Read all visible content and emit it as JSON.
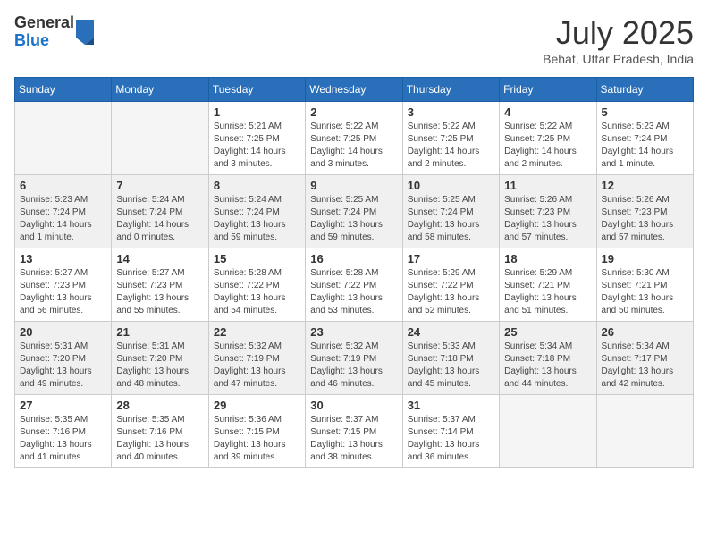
{
  "logo": {
    "general": "General",
    "blue": "Blue"
  },
  "header": {
    "month_year": "July 2025",
    "location": "Behat, Uttar Pradesh, India"
  },
  "weekdays": [
    "Sunday",
    "Monday",
    "Tuesday",
    "Wednesday",
    "Thursday",
    "Friday",
    "Saturday"
  ],
  "weeks": [
    {
      "shaded": false,
      "days": [
        {
          "num": "",
          "empty": true
        },
        {
          "num": "",
          "empty": true
        },
        {
          "num": "1",
          "sunrise": "Sunrise: 5:21 AM",
          "sunset": "Sunset: 7:25 PM",
          "daylight": "Daylight: 14 hours and 3 minutes."
        },
        {
          "num": "2",
          "sunrise": "Sunrise: 5:22 AM",
          "sunset": "Sunset: 7:25 PM",
          "daylight": "Daylight: 14 hours and 3 minutes."
        },
        {
          "num": "3",
          "sunrise": "Sunrise: 5:22 AM",
          "sunset": "Sunset: 7:25 PM",
          "daylight": "Daylight: 14 hours and 2 minutes."
        },
        {
          "num": "4",
          "sunrise": "Sunrise: 5:22 AM",
          "sunset": "Sunset: 7:25 PM",
          "daylight": "Daylight: 14 hours and 2 minutes."
        },
        {
          "num": "5",
          "sunrise": "Sunrise: 5:23 AM",
          "sunset": "Sunset: 7:24 PM",
          "daylight": "Daylight: 14 hours and 1 minute."
        }
      ]
    },
    {
      "shaded": true,
      "days": [
        {
          "num": "6",
          "sunrise": "Sunrise: 5:23 AM",
          "sunset": "Sunset: 7:24 PM",
          "daylight": "Daylight: 14 hours and 1 minute."
        },
        {
          "num": "7",
          "sunrise": "Sunrise: 5:24 AM",
          "sunset": "Sunset: 7:24 PM",
          "daylight": "Daylight: 14 hours and 0 minutes."
        },
        {
          "num": "8",
          "sunrise": "Sunrise: 5:24 AM",
          "sunset": "Sunset: 7:24 PM",
          "daylight": "Daylight: 13 hours and 59 minutes."
        },
        {
          "num": "9",
          "sunrise": "Sunrise: 5:25 AM",
          "sunset": "Sunset: 7:24 PM",
          "daylight": "Daylight: 13 hours and 59 minutes."
        },
        {
          "num": "10",
          "sunrise": "Sunrise: 5:25 AM",
          "sunset": "Sunset: 7:24 PM",
          "daylight": "Daylight: 13 hours and 58 minutes."
        },
        {
          "num": "11",
          "sunrise": "Sunrise: 5:26 AM",
          "sunset": "Sunset: 7:23 PM",
          "daylight": "Daylight: 13 hours and 57 minutes."
        },
        {
          "num": "12",
          "sunrise": "Sunrise: 5:26 AM",
          "sunset": "Sunset: 7:23 PM",
          "daylight": "Daylight: 13 hours and 57 minutes."
        }
      ]
    },
    {
      "shaded": false,
      "days": [
        {
          "num": "13",
          "sunrise": "Sunrise: 5:27 AM",
          "sunset": "Sunset: 7:23 PM",
          "daylight": "Daylight: 13 hours and 56 minutes."
        },
        {
          "num": "14",
          "sunrise": "Sunrise: 5:27 AM",
          "sunset": "Sunset: 7:23 PM",
          "daylight": "Daylight: 13 hours and 55 minutes."
        },
        {
          "num": "15",
          "sunrise": "Sunrise: 5:28 AM",
          "sunset": "Sunset: 7:22 PM",
          "daylight": "Daylight: 13 hours and 54 minutes."
        },
        {
          "num": "16",
          "sunrise": "Sunrise: 5:28 AM",
          "sunset": "Sunset: 7:22 PM",
          "daylight": "Daylight: 13 hours and 53 minutes."
        },
        {
          "num": "17",
          "sunrise": "Sunrise: 5:29 AM",
          "sunset": "Sunset: 7:22 PM",
          "daylight": "Daylight: 13 hours and 52 minutes."
        },
        {
          "num": "18",
          "sunrise": "Sunrise: 5:29 AM",
          "sunset": "Sunset: 7:21 PM",
          "daylight": "Daylight: 13 hours and 51 minutes."
        },
        {
          "num": "19",
          "sunrise": "Sunrise: 5:30 AM",
          "sunset": "Sunset: 7:21 PM",
          "daylight": "Daylight: 13 hours and 50 minutes."
        }
      ]
    },
    {
      "shaded": true,
      "days": [
        {
          "num": "20",
          "sunrise": "Sunrise: 5:31 AM",
          "sunset": "Sunset: 7:20 PM",
          "daylight": "Daylight: 13 hours and 49 minutes."
        },
        {
          "num": "21",
          "sunrise": "Sunrise: 5:31 AM",
          "sunset": "Sunset: 7:20 PM",
          "daylight": "Daylight: 13 hours and 48 minutes."
        },
        {
          "num": "22",
          "sunrise": "Sunrise: 5:32 AM",
          "sunset": "Sunset: 7:19 PM",
          "daylight": "Daylight: 13 hours and 47 minutes."
        },
        {
          "num": "23",
          "sunrise": "Sunrise: 5:32 AM",
          "sunset": "Sunset: 7:19 PM",
          "daylight": "Daylight: 13 hours and 46 minutes."
        },
        {
          "num": "24",
          "sunrise": "Sunrise: 5:33 AM",
          "sunset": "Sunset: 7:18 PM",
          "daylight": "Daylight: 13 hours and 45 minutes."
        },
        {
          "num": "25",
          "sunrise": "Sunrise: 5:34 AM",
          "sunset": "Sunset: 7:18 PM",
          "daylight": "Daylight: 13 hours and 44 minutes."
        },
        {
          "num": "26",
          "sunrise": "Sunrise: 5:34 AM",
          "sunset": "Sunset: 7:17 PM",
          "daylight": "Daylight: 13 hours and 42 minutes."
        }
      ]
    },
    {
      "shaded": false,
      "days": [
        {
          "num": "27",
          "sunrise": "Sunrise: 5:35 AM",
          "sunset": "Sunset: 7:16 PM",
          "daylight": "Daylight: 13 hours and 41 minutes."
        },
        {
          "num": "28",
          "sunrise": "Sunrise: 5:35 AM",
          "sunset": "Sunset: 7:16 PM",
          "daylight": "Daylight: 13 hours and 40 minutes."
        },
        {
          "num": "29",
          "sunrise": "Sunrise: 5:36 AM",
          "sunset": "Sunset: 7:15 PM",
          "daylight": "Daylight: 13 hours and 39 minutes."
        },
        {
          "num": "30",
          "sunrise": "Sunrise: 5:37 AM",
          "sunset": "Sunset: 7:15 PM",
          "daylight": "Daylight: 13 hours and 38 minutes."
        },
        {
          "num": "31",
          "sunrise": "Sunrise: 5:37 AM",
          "sunset": "Sunset: 7:14 PM",
          "daylight": "Daylight: 13 hours and 36 minutes."
        },
        {
          "num": "",
          "empty": true
        },
        {
          "num": "",
          "empty": true
        }
      ]
    }
  ]
}
